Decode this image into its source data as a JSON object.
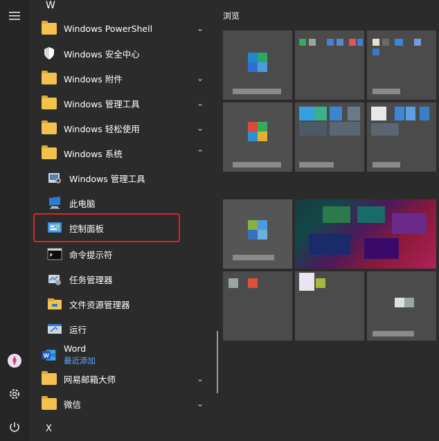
{
  "rail": {
    "menu_icon": "hamburger-icon",
    "user_icon": "user-avatar-icon",
    "settings_icon": "gear-icon",
    "power_icon": "power-icon"
  },
  "list": {
    "letter_w": "W",
    "letter_x": "X",
    "items": [
      {
        "label": "Windows PowerShell",
        "icon": "folder-icon",
        "chevron": "⌄"
      },
      {
        "label": "Windows 安全中心",
        "icon": "shield-icon"
      },
      {
        "label": "Windows 附件",
        "icon": "folder-icon",
        "chevron": "⌄"
      },
      {
        "label": "Windows 管理工具",
        "icon": "folder-icon",
        "chevron": "⌄"
      },
      {
        "label": "Windows 轻松使用",
        "icon": "folder-icon",
        "chevron": "⌄"
      },
      {
        "label": "Windows 系统",
        "icon": "folder-icon",
        "chevron": "⌃"
      },
      {
        "label": "Windows 管理工具",
        "icon": "admin-tools-icon"
      },
      {
        "label": "此电脑",
        "icon": "computer-icon"
      },
      {
        "label": "控制面板",
        "icon": "control-panel-icon"
      },
      {
        "label": "命令提示符",
        "icon": "command-prompt-icon"
      },
      {
        "label": "任务管理器",
        "icon": "task-manager-icon"
      },
      {
        "label": "文件资源管理器",
        "icon": "file-explorer-icon"
      },
      {
        "label": "运行",
        "icon": "run-icon"
      },
      {
        "label": "Word",
        "sublabel": "最近添加",
        "icon": "word-icon"
      },
      {
        "label": "网易邮箱大师",
        "icon": "folder-icon",
        "chevron": "⌄"
      },
      {
        "label": "微信",
        "icon": "folder-icon",
        "chevron": "⌄"
      }
    ]
  },
  "tiles": {
    "section_title": "浏览"
  },
  "colors": {
    "background": "#2b2b2b",
    "rail": "#262626",
    "folder": "#f2c14e",
    "highlight": "#e02424",
    "accent_blue": "#2b7cd3",
    "sublabel": "#5ea8ff"
  }
}
